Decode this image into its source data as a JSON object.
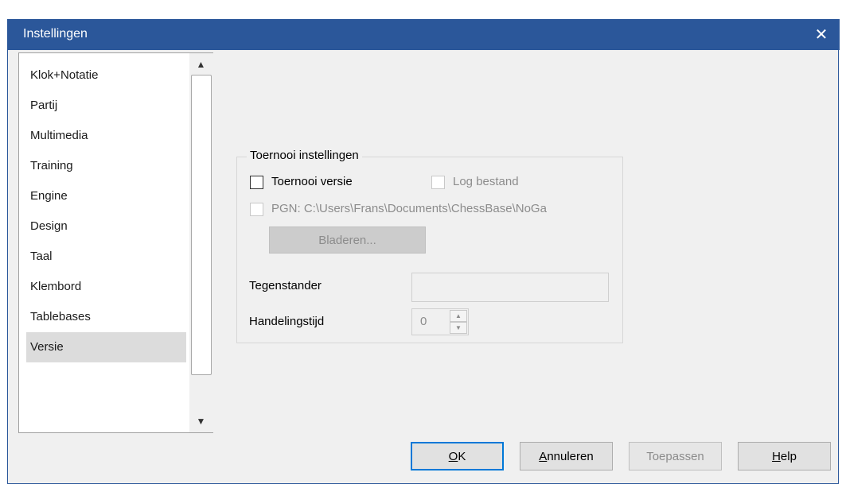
{
  "window": {
    "title": "Instellingen",
    "close_glyph": "✕"
  },
  "sidebar": {
    "items": [
      {
        "label": "Klok+Notatie",
        "selected": false
      },
      {
        "label": "Partij",
        "selected": false
      },
      {
        "label": "Multimedia",
        "selected": false
      },
      {
        "label": "Training",
        "selected": false
      },
      {
        "label": "Engine",
        "selected": false
      },
      {
        "label": "Design",
        "selected": false
      },
      {
        "label": "Taal",
        "selected": false
      },
      {
        "label": "Klembord",
        "selected": false
      },
      {
        "label": "Tablebases",
        "selected": false
      },
      {
        "label": "Versie",
        "selected": true
      }
    ],
    "scroll_up_glyph": "▲",
    "scroll_down_glyph": "▼"
  },
  "tournament": {
    "group_label": "Toernooi instellingen",
    "tournament_version": {
      "label": "Toernooi versie",
      "checked": false,
      "enabled": true
    },
    "log_file": {
      "label": "Log bestand",
      "checked": false,
      "enabled": false
    },
    "pgn": {
      "label": "PGN: C:\\Users\\Frans\\Documents\\ChessBase\\NoGa",
      "checked": false,
      "enabled": false
    },
    "browse_label": "Bladeren...",
    "opponent_label": "Tegenstander",
    "opponent_value": "",
    "handling_time_label": "Handelingstijd",
    "handling_time_value": "0",
    "spin_up_glyph": "▲",
    "spin_down_glyph": "▼"
  },
  "buttons": {
    "ok": {
      "mnemonic": "O",
      "rest": "K"
    },
    "cancel": {
      "mnemonic": "A",
      "rest": "nnuleren"
    },
    "apply": {
      "label": "Toepassen"
    },
    "help": {
      "mnemonic": "H",
      "rest": "elp"
    }
  },
  "colors": {
    "titlebar": "#2b579a",
    "dialog_bg": "#f0f0f0",
    "selected_item": "#dcdcdc",
    "default_button_border": "#0078d7",
    "disabled_text": "#8c8c8c"
  },
  "icons": {
    "close": "close-icon",
    "scroll_up": "arrow-up-icon",
    "scroll_down": "arrow-down-icon",
    "spin_up": "spin-up-icon",
    "spin_down": "spin-down-icon"
  }
}
